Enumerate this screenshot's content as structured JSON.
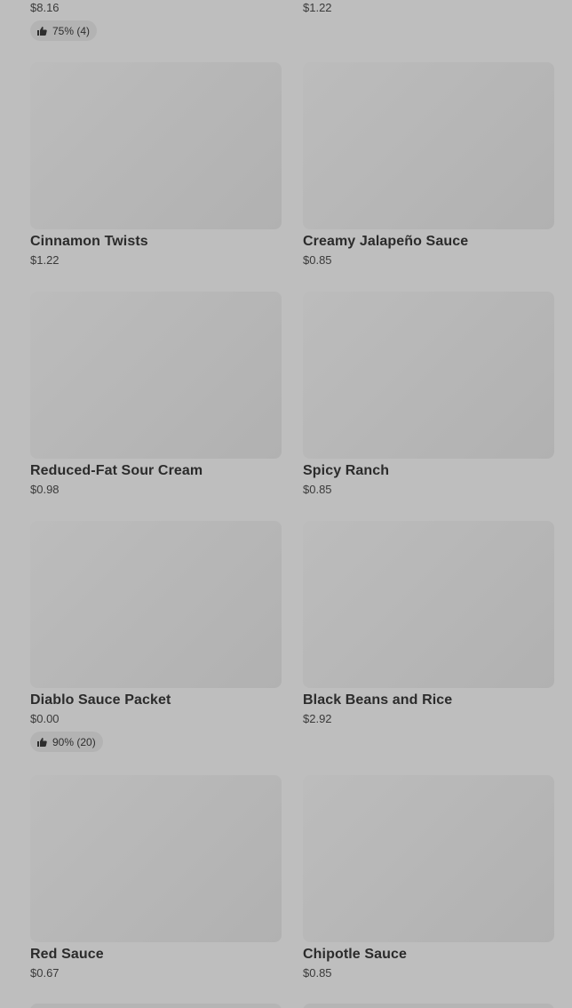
{
  "partial_top": [
    {
      "price": "$8.16",
      "rating": "75% (4)"
    },
    {
      "price": "$1.22"
    }
  ],
  "items": [
    {
      "name": "Cinnamon Twists",
      "price": "$1.22"
    },
    {
      "name": "Creamy Jalapeño Sauce",
      "price": "$0.85"
    },
    {
      "name": "Reduced-Fat Sour Cream",
      "price": "$0.98"
    },
    {
      "name": "Spicy Ranch",
      "price": "$0.85"
    },
    {
      "name": "Diablo Sauce Packet",
      "price": "$0.00",
      "rating": "90% (20)"
    },
    {
      "name": "Black Beans and Rice",
      "price": "$2.92"
    },
    {
      "name": "Red Sauce",
      "price": "$0.67"
    },
    {
      "name": "Chipotle Sauce",
      "price": "$0.85"
    }
  ],
  "icons": {
    "rating": "thumbs-up-icon"
  }
}
